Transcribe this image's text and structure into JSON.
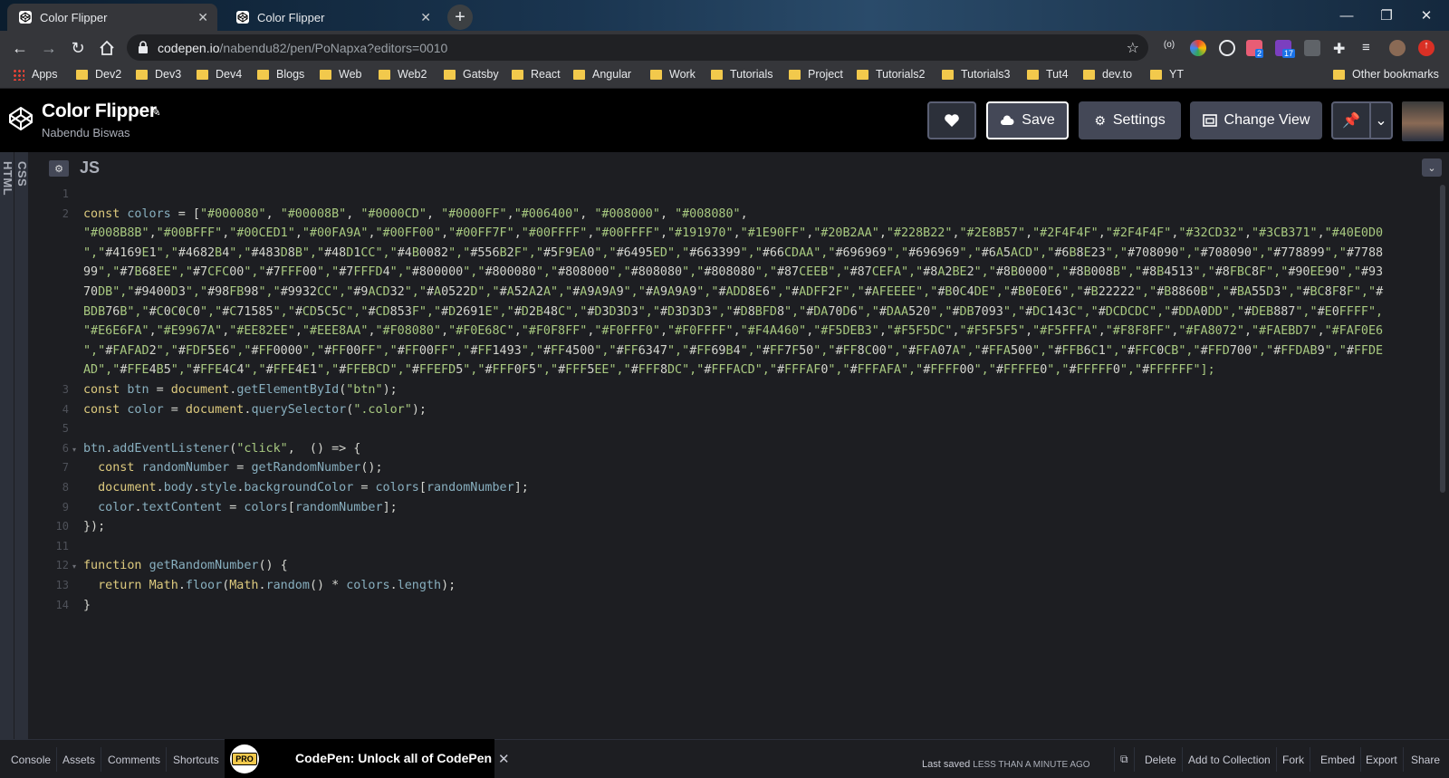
{
  "browser": {
    "tabs": [
      {
        "title": "Color Flipper",
        "active": true
      },
      {
        "title": "Color Flipper",
        "active": false
      }
    ],
    "new_tab_symbol": "+",
    "window_controls": [
      "—",
      "❐",
      "✕"
    ],
    "url_host": "codepen.io",
    "url_path": "/nabendu82/pen/PoNapxa?editors=0010",
    "bookmarks": [
      "Apps",
      "Dev2",
      "Dev3",
      "Dev4",
      "Blogs",
      "Web",
      "Web2",
      "Gatsby",
      "React",
      "Angular",
      "Work",
      "Tutorials",
      "Project",
      "Tutorials2",
      "Tutorials3",
      "Tut4",
      "dev.to",
      "YT"
    ],
    "other_bookmarks": "Other bookmarks",
    "extension_badges": [
      "2",
      "17"
    ]
  },
  "codepen": {
    "title": "Color Flipper",
    "author": "Nabendu Biswas",
    "save_label": "Save",
    "settings_label": "Settings",
    "change_view_label": "Change View",
    "side_panes": [
      "HTML",
      "CSS"
    ],
    "editor_label": "JS"
  },
  "code_lines": [
    {
      "n": "1",
      "text": ""
    },
    {
      "n": "2",
      "text": "const colors = [\"#000080\", \"#00008B\", \"#0000CD\", \"#0000FF\",\"#006400\", \"#008000\", \"#008080\","
    },
    {
      "n": "",
      "text": "\"#008B8B\",\"#00BFFF\",\"#00CED1\",\"#00FA9A\",\"#00FF00\",\"#00FF7F\",\"#00FFFF\",\"#00FFFF\",\"#191970\",\"#1E90FF\",\"#20B2AA\",\"#228B22\",\"#2E8B57\",\"#2F4F4F\",\"#2F4F4F\",\"#32CD32\",\"#3CB371\",\"#40E0D0"
    },
    {
      "n": "",
      "text": "\",\"#4169E1\",\"#4682B4\",\"#483D8B\",\"#48D1CC\",\"#4B0082\",\"#556B2F\",\"#5F9EA0\",\"#6495ED\",\"#663399\",\"#66CDAA\",\"#696969\",\"#696969\",\"#6A5ACD\",\"#6B8E23\",\"#708090\",\"#708090\",\"#778899\",\"#7788"
    },
    {
      "n": "",
      "text": "99\",\"#7B68EE\",\"#7CFC00\",\"#7FFF00\",\"#7FFFD4\",\"#800000\",\"#800080\",\"#808000\",\"#808080\",\"#808080\",\"#87CEEB\",\"#87CEFA\",\"#8A2BE2\",\"#8B0000\",\"#8B008B\",\"#8B4513\",\"#8FBC8F\",\"#90EE90\",\"#93"
    },
    {
      "n": "",
      "text": "70DB\",\"#9400D3\",\"#98FB98\",\"#9932CC\",\"#9ACD32\",\"#A0522D\",\"#A52A2A\",\"#A9A9A9\",\"#A9A9A9\",\"#ADD8E6\",\"#ADFF2F\",\"#AFEEEE\",\"#B0C4DE\",\"#B0E0E6\",\"#B22222\",\"#B8860B\",\"#BA55D3\",\"#BC8F8F\",\"#"
    },
    {
      "n": "",
      "text": "BDB76B\",\"#C0C0C0\",\"#C71585\",\"#CD5C5C\",\"#CD853F\",\"#D2691E\",\"#D2B48C\",\"#D3D3D3\",\"#D3D3D3\",\"#D8BFD8\",\"#DA70D6\",\"#DAA520\",\"#DB7093\",\"#DC143C\",\"#DCDCDC\",\"#DDA0DD\",\"#DEB887\",\"#E0FFFF\","
    },
    {
      "n": "",
      "text": "\"#E6E6FA\",\"#E9967A\",\"#EE82EE\",\"#EEE8AA\",\"#F08080\",\"#F0E68C\",\"#F0F8FF\",\"#F0FFF0\",\"#F0FFFF\",\"#F4A460\",\"#F5DEB3\",\"#F5F5DC\",\"#F5F5F5\",\"#F5FFFA\",\"#F8F8FF\",\"#FA8072\",\"#FAEBD7\",\"#FAF0E6"
    },
    {
      "n": "",
      "text": "\",\"#FAFAD2\",\"#FDF5E6\",\"#FF0000\",\"#FF00FF\",\"#FF00FF\",\"#FF1493\",\"#FF4500\",\"#FF6347\",\"#FF69B4\",\"#FF7F50\",\"#FF8C00\",\"#FFA07A\",\"#FFA500\",\"#FFB6C1\",\"#FFC0CB\",\"#FFD700\",\"#FFDAB9\",\"#FFDE"
    },
    {
      "n": "",
      "text": "AD\",\"#FFE4B5\",\"#FFE4C4\",\"#FFE4E1\",\"#FFEBCD\",\"#FFEFD5\",\"#FFF0F5\",\"#FFF5EE\",\"#FFF8DC\",\"#FFFACD\",\"#FFFAF0\",\"#FFFAFA\",\"#FFFF00\",\"#FFFFE0\",\"#FFFFF0\",\"#FFFFFF\"];"
    },
    {
      "n": "3",
      "text": "const btn = document.getElementById(\"btn\");"
    },
    {
      "n": "4",
      "text": "const color = document.querySelector(\".color\");"
    },
    {
      "n": "5",
      "text": ""
    },
    {
      "n": "6",
      "text": "btn.addEventListener(\"click\",  () => {"
    },
    {
      "n": "7",
      "text": "  const randomNumber = getRandomNumber();"
    },
    {
      "n": "8",
      "text": "  document.body.style.backgroundColor = colors[randomNumber];"
    },
    {
      "n": "9",
      "text": "  color.textContent = colors[randomNumber];"
    },
    {
      "n": "10",
      "text": "});"
    },
    {
      "n": "11",
      "text": ""
    },
    {
      "n": "12",
      "text": "function getRandomNumber() {"
    },
    {
      "n": "13",
      "text": "  return Math.floor(Math.random() * colors.length);"
    },
    {
      "n": "14",
      "text": "}"
    }
  ],
  "bottom_bar": {
    "left": [
      "Console",
      "Assets",
      "Comments",
      "Shortcuts"
    ],
    "pro_badge": "PRO",
    "promo": "CodePen: Unlock all of CodePen",
    "promo_close": "✕",
    "last_saved_label": "Last saved",
    "last_saved_value": "LESS THAN A MINUTE ago",
    "right": [
      "Delete",
      "Add to Collection",
      "Fork",
      "Embed",
      "Export",
      "Share"
    ]
  },
  "colors": {
    "editor_bg": "#1d1e22",
    "keyword": "#ddca7e",
    "string": "#a8c980",
    "identifier": "#88afbf",
    "header_bg": "#000000",
    "button_bg": "#444857"
  }
}
